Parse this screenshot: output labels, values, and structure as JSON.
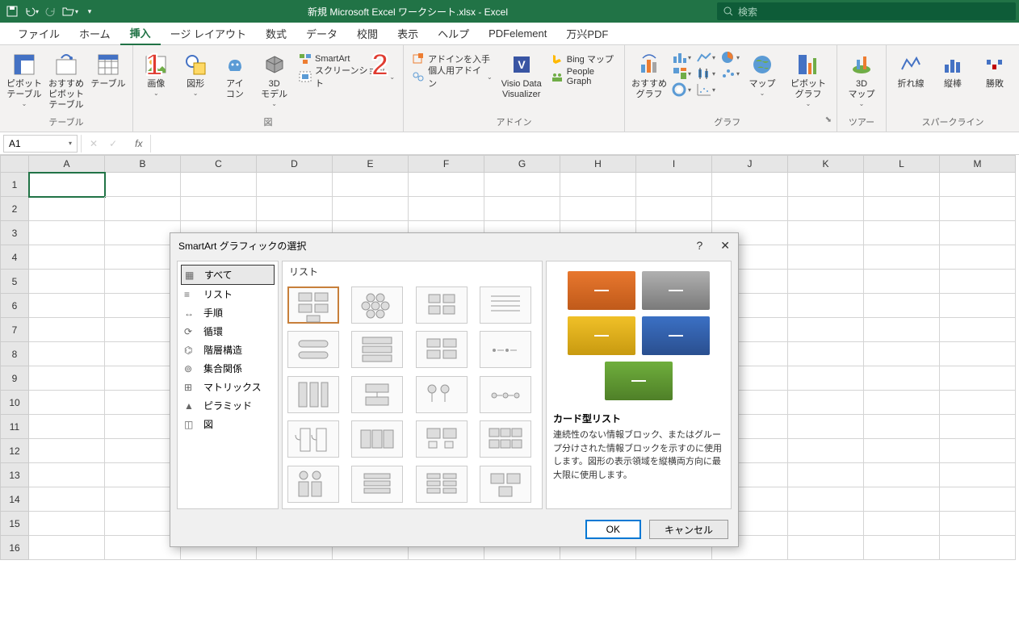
{
  "title": "新規 Microsoft Excel ワークシート.xlsx  -  Excel",
  "search_placeholder": "検索",
  "tabs": [
    "ファイル",
    "ホーム",
    "挿入",
    "ージ レイアウト",
    "数式",
    "データ",
    "校閲",
    "表示",
    "ヘルプ",
    "PDFelement",
    "万兴PDF"
  ],
  "active_tab": 2,
  "ribbon": {
    "group_table": "テーブル",
    "pivot": "ピボット\nテーブル",
    "rec_pivot": "おすすめ\nピボットテーブル",
    "table": "テーブル",
    "group_illus": "図",
    "images": "画像",
    "shapes": "図形",
    "icons": "アイ\nコン",
    "model3d": "3D\nモデル",
    "smartart": "SmartArt",
    "screenshot": "スクリーンショット",
    "group_addin": "アドイン",
    "get_addin": "アドインを入手",
    "my_addin": "個人用アドイン",
    "visio": "Visio Data\nVisualizer",
    "bing": "Bing マップ",
    "people": "People Graph",
    "group_chart": "グラフ",
    "rec_chart": "おすすめ\nグラフ",
    "map": "マップ",
    "pivotchart": "ピボットグラフ",
    "group_tour": "ツアー",
    "map3d": "3D\nマップ",
    "group_spark": "スパークライン",
    "line": "折れ線",
    "column": "縦棒",
    "winloss": "勝敗"
  },
  "name_box": "A1",
  "columns": [
    "A",
    "B",
    "C",
    "D",
    "E",
    "F",
    "G",
    "H",
    "I",
    "J",
    "K",
    "L",
    "M"
  ],
  "rows": [
    "1",
    "2",
    "3",
    "4",
    "5",
    "6",
    "7",
    "8",
    "9",
    "10",
    "11",
    "12",
    "13",
    "14",
    "15",
    "16"
  ],
  "dialog": {
    "title": "SmartArt グラフィックの選択",
    "categories": [
      "すべて",
      "リスト",
      "手順",
      "循環",
      "階層構造",
      "集合関係",
      "マトリックス",
      "ピラミッド",
      "図"
    ],
    "mid_header": "リスト",
    "preview_title": "カード型リスト",
    "preview_desc": "連続性のない情報ブロック、またはグループ分けされた情報ブロックを示すのに使用します。図形の表示領域を縦横両方向に最大限に使用します。",
    "ok": "OK",
    "cancel": "キャンセル"
  },
  "anno": {
    "a1": "1",
    "a2": "2"
  }
}
